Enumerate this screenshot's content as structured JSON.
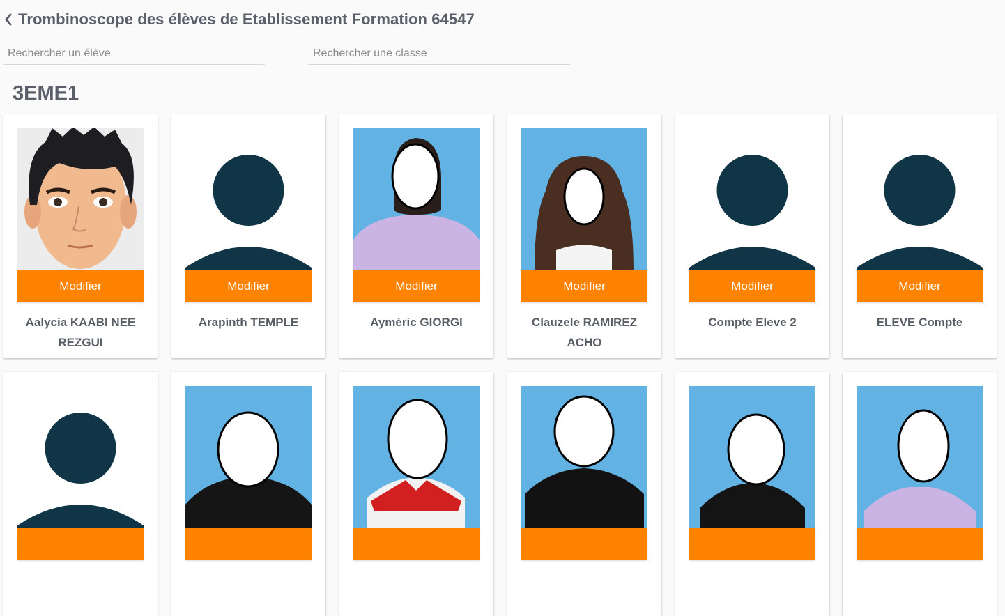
{
  "header": {
    "title": "Trombinoscope des élèves de Etablissement Formation 64547"
  },
  "search": {
    "student_placeholder": "Rechercher un élève",
    "class_placeholder": "Rechercher une classe"
  },
  "class_section": {
    "name": "3EME1"
  },
  "colors": {
    "accent": "#ff8200",
    "avatar": "#0f3546",
    "photo_bg": "#5aaee0"
  },
  "students": [
    {
      "name": "Aalycia KAABI NEE REZGUI",
      "modify_label": "Modifier",
      "photo": "cartoon-avatar"
    },
    {
      "name": "Arapinth TEMPLE",
      "modify_label": "Modifier",
      "photo": "default-avatar"
    },
    {
      "name": "Ayméric GIORGI",
      "modify_label": "Modifier",
      "photo": "student-photo"
    },
    {
      "name": "Clauzele RAMIREZ ACHO",
      "modify_label": "Modifier",
      "photo": "student-photo"
    },
    {
      "name": "Compte Eleve 2",
      "modify_label": "Modifier",
      "photo": "default-avatar"
    },
    {
      "name": "ELEVE Compte",
      "modify_label": "Modifier",
      "photo": "default-avatar"
    },
    {
      "name": "",
      "modify_label": "",
      "photo": "default-avatar"
    },
    {
      "name": "",
      "modify_label": "",
      "photo": "student-photo"
    },
    {
      "name": "",
      "modify_label": "",
      "photo": "student-photo"
    },
    {
      "name": "",
      "modify_label": "",
      "photo": "student-photo"
    },
    {
      "name": "",
      "modify_label": "",
      "photo": "student-photo"
    },
    {
      "name": "",
      "modify_label": "",
      "photo": "student-photo"
    }
  ]
}
